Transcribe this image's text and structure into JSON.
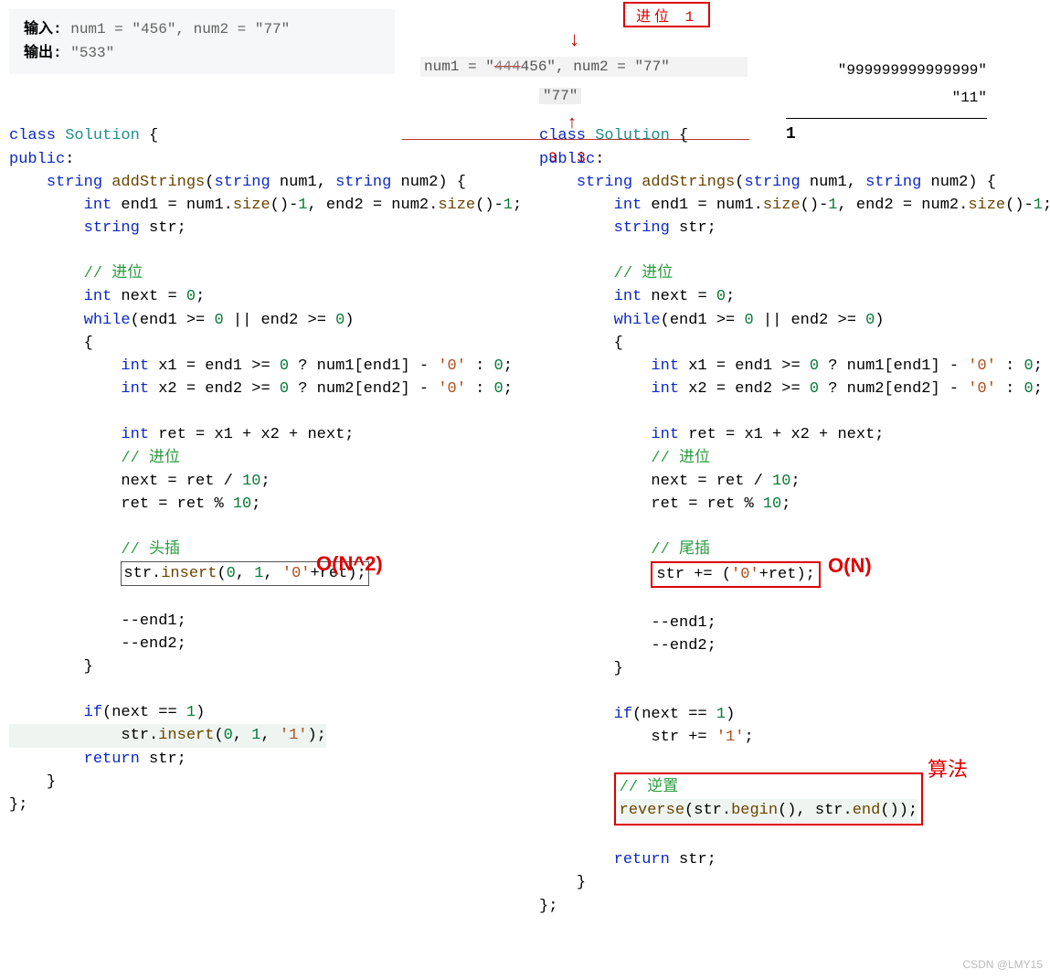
{
  "top": {
    "input_label": "输入:",
    "input_text": " num1 = \"456\", num2 = \"77\"",
    "output_label": "输出:",
    "output_text": " \"533\""
  },
  "diagram": {
    "carry": "进位 1",
    "line1_pre": "num1 = \"",
    "line1_strike": "444",
    "line1_post": "456\", num2 = \"77\"",
    "line2": "\"77\"",
    "result": "3 3",
    "big1": "\"999999999999999\"",
    "big2": "\"11\"",
    "one": "1"
  },
  "code_left": {
    "l1a": "class",
    "l1b": "Solution",
    "l1c": " {",
    "l2": "public",
    "l3a": "string",
    "l3b": "addStrings",
    "l3c": "string",
    "l3d": " num1, ",
    "l3e": "string",
    "l3f": " num2) {",
    "l4a": "int",
    "l4b": " end1 = num1.",
    "l4c": "size",
    "l4d": "()-",
    "l4e": "1",
    "l4f": ", end2 = num2.",
    "l4g": "size",
    "l4h": "()-",
    "l4i": "1",
    "l4j": ";",
    "l5a": "string",
    "l5b": " str;",
    "l7": "// 进位",
    "l8a": "int",
    "l8b": " next = ",
    "l8c": "0",
    "l8d": ";",
    "l9a": "while",
    "l9b": "(end1 >= ",
    "l9c": "0",
    "l9d": " || end2 >= ",
    "l9e": "0",
    "l9f": ")",
    "l10": "{",
    "l11a": "int",
    "l11b": " x1 = end1 >= ",
    "l11c": "0",
    "l11d": " ? num1[end1] - ",
    "l11e": "'0'",
    "l11f": " : ",
    "l11g": "0",
    "l11h": ";",
    "l12a": "int",
    "l12b": " x2 = end2 >= ",
    "l12c": "0",
    "l12d": " ? num2[end2] - ",
    "l12e": "'0'",
    "l12f": " : ",
    "l12g": "0",
    "l12h": ";",
    "l14a": "int",
    "l14b": " ret = x1 + x2 + next;",
    "l15": "// 进位",
    "l16a": "next = ret / ",
    "l16b": "10",
    "l16c": ";",
    "l17a": "ret = ret % ",
    "l17b": "10",
    "l17c": ";",
    "l19": "// 头插",
    "l20a": "str.",
    "l20b": "insert",
    "l20c": "(",
    "l20d": "0",
    "l20e": ", ",
    "l20f": "1",
    "l20g": ", ",
    "l20h": "'0'",
    "l20i": "+ret);",
    "l22": "--end1;",
    "l23": "--end2;",
    "l24": "}",
    "l26a": "if",
    "l26b": "(next == ",
    "l26c": "1",
    "l26d": ")",
    "l27a": "str.",
    "l27b": "insert",
    "l27c": "(",
    "l27d": "0",
    "l27e": ", ",
    "l27f": "1",
    "l27g": ", ",
    "l27h": "'1'",
    "l27i": ");",
    "l28a": "return",
    "l28b": " str;",
    "l29": "}",
    "l30": "};",
    "annot": "O(N^2)"
  },
  "code_right": {
    "l1a": "class",
    "l1b": "Solution",
    "l1c": " {",
    "l2": "public",
    "l3a": "string",
    "l3b": "addStrings",
    "l3c": "string",
    "l3d": " num1, ",
    "l3e": "string",
    "l3f": " num2) {",
    "l4a": "int",
    "l4b": " end1 = num1.",
    "l4c": "size",
    "l4d": "()-",
    "l4e": "1",
    "l4f": ", end2 = num2.",
    "l4g": "size",
    "l4h": "()-",
    "l4i": "1",
    "l4j": ";",
    "l5a": "string",
    "l5b": " str;",
    "l7": "// 进位",
    "l8a": "int",
    "l8b": " next = ",
    "l8c": "0",
    "l8d": ";",
    "l9a": "while",
    "l9b": "(end1 >= ",
    "l9c": "0",
    "l9d": " || end2 >= ",
    "l9e": "0",
    "l9f": ")",
    "l10": "{",
    "l11a": "int",
    "l11b": " x1 = end1 >= ",
    "l11c": "0",
    "l11d": " ? num1[end1] - ",
    "l11e": "'0'",
    "l11f": " : ",
    "l11g": "0",
    "l11h": ";",
    "l12a": "int",
    "l12b": " x2 = end2 >= ",
    "l12c": "0",
    "l12d": " ? num2[end2] - ",
    "l12e": "'0'",
    "l12f": " : ",
    "l12g": "0",
    "l12h": ";",
    "l14a": "int",
    "l14b": " ret = x1 + x2 + next;",
    "l15": "// 进位",
    "l16a": "next = ret / ",
    "l16b": "10",
    "l16c": ";",
    "l17a": "ret = ret % ",
    "l17b": "10",
    "l17c": ";",
    "l19": "// 尾插",
    "l20a": "str += (",
    "l20b": "'0'",
    "l20c": "+ret);",
    "l22": "--end1;",
    "l23": "--end2;",
    "l24": "}",
    "l26a": "if",
    "l26b": "(next == ",
    "l26c": "1",
    "l26d": ")",
    "l27a": "str += ",
    "l27b": "'1'",
    "l27c": ";",
    "l29": "// 逆置",
    "l30a": "reverse",
    "l30b": "(str.",
    "l30c": "begin",
    "l30d": "(), str.",
    "l30e": "end",
    "l30f": "());",
    "l32a": "return",
    "l32b": " str;",
    "l33": "}",
    "l34": "};",
    "annot": "O(N)",
    "revlabel": "算法"
  },
  "watermark": "CSDN @LMY15"
}
